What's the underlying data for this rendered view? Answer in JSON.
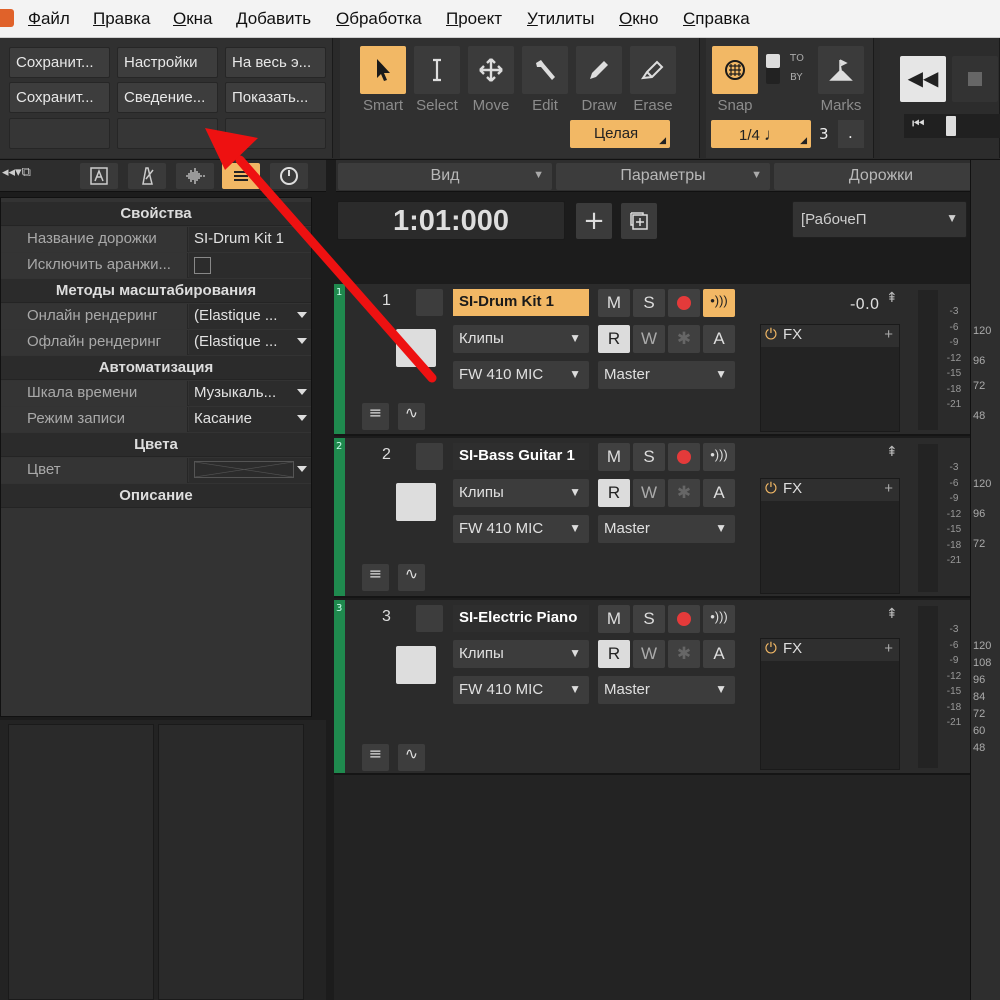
{
  "menu": [
    "Файл",
    "Правка",
    "Окна",
    "Добавить",
    "Обработка",
    "Проект",
    "Утилиты",
    "Окно",
    "Справка"
  ],
  "quick_buttons": {
    "row1": [
      "Сохранит...",
      "Настройки",
      "На весь э..."
    ],
    "row2": [
      "Сохранит...",
      "Сведение...",
      "Показать..."
    ]
  },
  "tools": [
    {
      "name": "Smart",
      "icon": "pointer-icon",
      "active": true
    },
    {
      "name": "Select",
      "icon": "ibeam-icon"
    },
    {
      "name": "Move",
      "icon": "move-icon"
    },
    {
      "name": "Edit",
      "icon": "edit-icon"
    },
    {
      "name": "Draw",
      "icon": "pencil-icon"
    },
    {
      "name": "Erase",
      "icon": "eraser-icon"
    }
  ],
  "tools_dropdown": "Целая",
  "snap": {
    "label": "Snap",
    "to": "TO",
    "by": "BY",
    "value": "1/4",
    "triplet": "3",
    "dot": "."
  },
  "marks_label": "Marks",
  "view_bar": {
    "view": "Вид",
    "params": "Параметры",
    "tracks": "Дорожки"
  },
  "timecode": "1:01:000",
  "workspace": "[РабочеП",
  "inspector": {
    "sections": {
      "properties": "Свойства",
      "scaling": "Методы масштабирования",
      "automation": "Автоматизация",
      "colors": "Цвета",
      "description": "Описание"
    },
    "rows": {
      "track_name": {
        "label": "Название дорожки",
        "value": "SI-Drum Kit 1"
      },
      "exclude": {
        "label": "Исключить аранжи..."
      },
      "online": {
        "label": "Онлайн рендеринг",
        "value": "(Elastique ..."
      },
      "offline": {
        "label": "Офлайн рендеринг",
        "value": "(Elastique ..."
      },
      "timescale": {
        "label": "Шкала времени",
        "value": "Музыкаль..."
      },
      "rec_mode": {
        "label": "Режим записи",
        "value": "Касание"
      },
      "color": {
        "label": "Цвет"
      }
    }
  },
  "tracks": [
    {
      "num": "1",
      "name": "SI-Drum Kit 1",
      "selected": true,
      "volume": "-0.0",
      "clips": "Клипы",
      "input": "FW 410 MIC",
      "output": "Master",
      "fx": "FX"
    },
    {
      "num": "2",
      "name": "SI-Bass Guitar 1",
      "selected": false,
      "clips": "Клипы",
      "input": "FW 410 MIC",
      "output": "Master",
      "fx": "FX"
    },
    {
      "num": "3",
      "name": "SI-Electric Piano",
      "selected": false,
      "clips": "Клипы",
      "input": "FW 410 MIC",
      "output": "Master",
      "fx": "FX"
    }
  ],
  "track_buttons": {
    "mute": "M",
    "solo": "S",
    "read": "R",
    "write": "W",
    "auto": "A"
  },
  "db_scale": [
    "-3",
    "-6",
    "-9",
    "-12",
    "-15",
    "-18",
    "-21"
  ],
  "right_ruler": [
    "120",
    "96",
    "72",
    "48",
    "120",
    "96",
    "72",
    "120",
    "108",
    "96",
    "84",
    "72",
    "60",
    "48"
  ],
  "colors": {
    "accent": "#f2b865",
    "track": "#1f8a4e",
    "record": "#e43a3a",
    "arrow": "#ee1111"
  }
}
